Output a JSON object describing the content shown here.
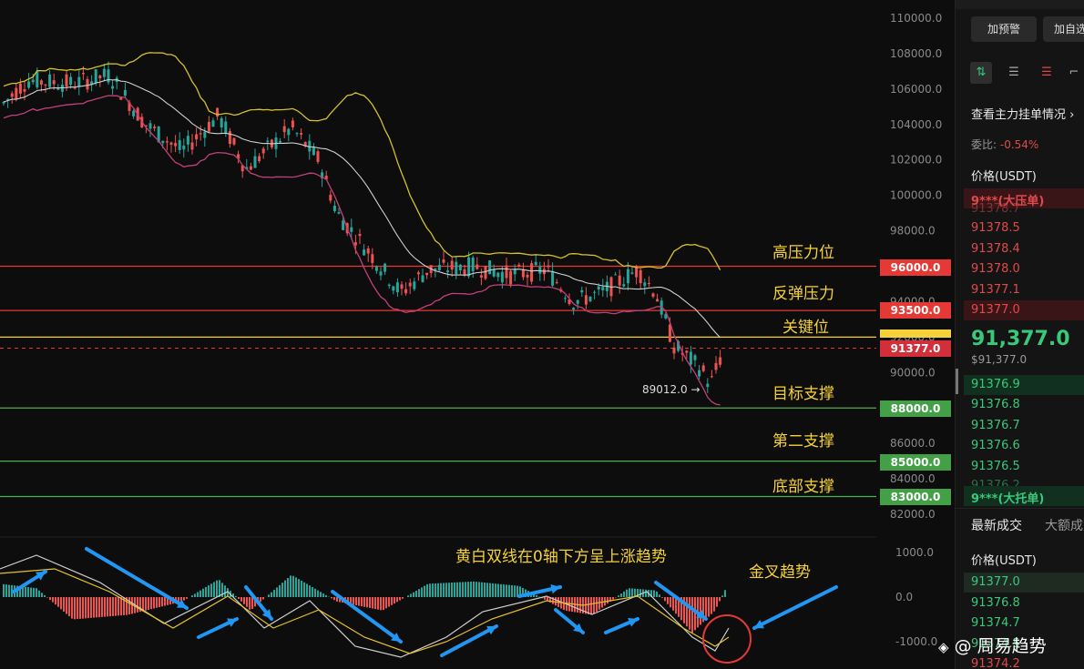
{
  "chart_data": {
    "type": "candlestick",
    "y_ticks": [
      "110000.0",
      "108000.0",
      "106000.0",
      "104000.0",
      "102000.0",
      "100000.0",
      "98000.0",
      "96000.0",
      "94000.0",
      "92000.0",
      "90000.0",
      "88000.0",
      "86000.0",
      "84000.0",
      "82000.0"
    ],
    "ylim": [
      81500,
      111000
    ],
    "levels": [
      {
        "price": 96000,
        "label": "96000.0",
        "color": "#e53935",
        "annotation": "高压力位"
      },
      {
        "price": 93500,
        "label": "93500.0",
        "color": "#e53935",
        "annotation": "反弹压力"
      },
      {
        "price": 92000,
        "label": "",
        "color": "#f5d23a",
        "annotation": "关键位"
      },
      {
        "price": 88000,
        "label": "88000.0",
        "color": "#4caf50",
        "annotation": "目标支撑"
      },
      {
        "price": 85000,
        "label": "85000.0",
        "color": "#4caf50",
        "annotation": "第二支撑"
      },
      {
        "price": 83000,
        "label": "83000.0",
        "color": "#4caf50",
        "annotation": "底部支撑"
      }
    ],
    "current_price": {
      "value": 91377,
      "label": "91377.0"
    },
    "low_marker": {
      "value": 89012,
      "label": "89012.0 →"
    },
    "macd": {
      "y_ticks": [
        "1000.0",
        "0.0",
        "-1000.0"
      ],
      "ylim": [
        -1350,
        1350
      ],
      "annotation_main": "黄白双线在0轴下方呈上涨趋势",
      "annotation_cross": "金叉趋势"
    }
  },
  "sidebar": {
    "buttons": [
      "加预警",
      "加自选"
    ],
    "order_book_link": "查看主力挂单情况",
    "ratio_label": "委比:",
    "ratio_value": "-0.54%",
    "price_header": "价格(USDT)",
    "big_ask_label": "9***(大压单)",
    "asks": [
      "91378.7",
      "91378.5",
      "91378.4",
      "91378.0",
      "91377.1",
      "91377.0"
    ],
    "last_price": "91,377.0",
    "last_price_sub": "$91,377.0",
    "bids": [
      "91376.9",
      "91376.8",
      "91376.7",
      "91376.6",
      "91376.5",
      "91376.2"
    ],
    "big_bid_label": "9***(大托单)",
    "tabs": [
      "最新成交",
      "大额成"
    ],
    "trades_header": "价格(USDT)",
    "trades": [
      "91377.0",
      "91376.8",
      "91374.7",
      "91374.5",
      "91374.2"
    ]
  },
  "watermark": "@ 周易趋势",
  "colors": {
    "up": "#26a69a",
    "down": "#ef5350",
    "yellow": "#f5d23a",
    "white_line": "#cfcfcf",
    "pink": "#c2407a",
    "blue": "#2196f3"
  }
}
